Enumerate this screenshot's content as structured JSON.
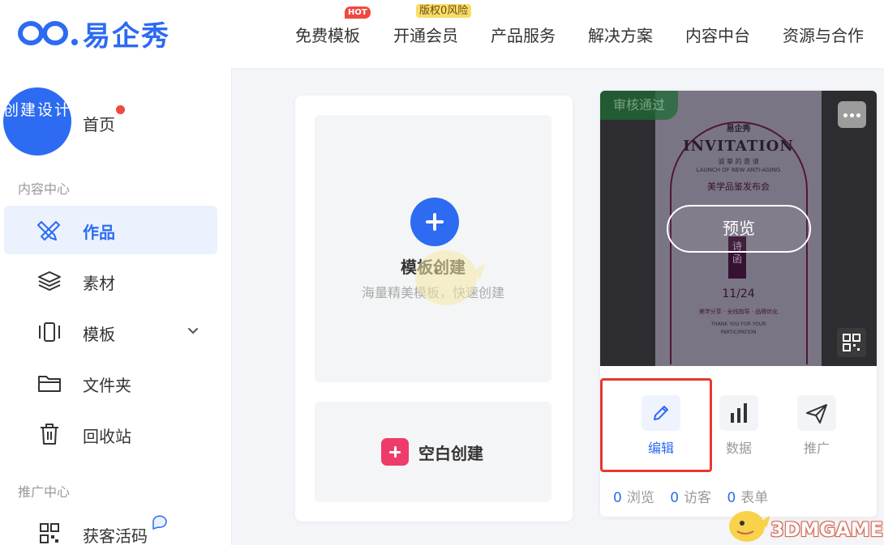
{
  "brand": {
    "name": "易企秀",
    "color": "#2c6bf2"
  },
  "nav": {
    "items": [
      {
        "label": "免费模板",
        "badge": "HOT"
      },
      {
        "label": "开通会员",
        "badge": "版权0风险"
      },
      {
        "label": "产品服务"
      },
      {
        "label": "解决方案"
      },
      {
        "label": "内容中台"
      },
      {
        "label": "资源与合作"
      }
    ]
  },
  "sidebar": {
    "create_label": "创建设计",
    "home_label": "首页",
    "sections": [
      {
        "title": "内容中心"
      },
      {
        "title": "推广中心"
      }
    ],
    "items": [
      {
        "label": "作品",
        "icon": "pencil-ruler-icon",
        "active": true
      },
      {
        "label": "素材",
        "icon": "layers-icon"
      },
      {
        "label": "模板",
        "icon": "template-carousel-icon",
        "expandable": true
      },
      {
        "label": "文件夹",
        "icon": "folder-icon"
      },
      {
        "label": "回收站",
        "icon": "trash-icon"
      },
      {
        "label": "获客活码",
        "icon": "qr-code-icon"
      }
    ]
  },
  "main": {
    "template_create": {
      "title": "模板创建",
      "subtitle": "海量精美模板，快速创建"
    },
    "blank_create": {
      "label": "空白创建"
    }
  },
  "work_card": {
    "status": "审核通过",
    "preview_label": "预览",
    "poster": {
      "brand": "易企秀",
      "title": "INVITATION",
      "subtitle_cn": "诚 挚 的 邀 请",
      "subtitle_en": "LAUNCH OF NEW ANTI-AGING",
      "event": "美学品鉴发布会",
      "box": "诗 函",
      "date": "11/24",
      "tagline": "美学分享 · 全线指导 · 品牌优化",
      "thanks": "THANK YOU FOR YOUR",
      "thanks2": "PARTICIPATION"
    },
    "actions": [
      {
        "label": "编辑",
        "icon": "pencil-icon",
        "highlighted": true
      },
      {
        "label": "数据",
        "icon": "bar-chart-icon"
      },
      {
        "label": "推广",
        "icon": "send-icon"
      }
    ],
    "stats": [
      {
        "value": "0",
        "label": "浏览"
      },
      {
        "value": "0",
        "label": "访客"
      },
      {
        "value": "0",
        "label": "表单"
      }
    ]
  },
  "watermark": {
    "text": "3DMGAME"
  },
  "colors": {
    "accent": "#2c6bf2",
    "alert": "#e53a2f",
    "pink": "#ee3b6a"
  }
}
